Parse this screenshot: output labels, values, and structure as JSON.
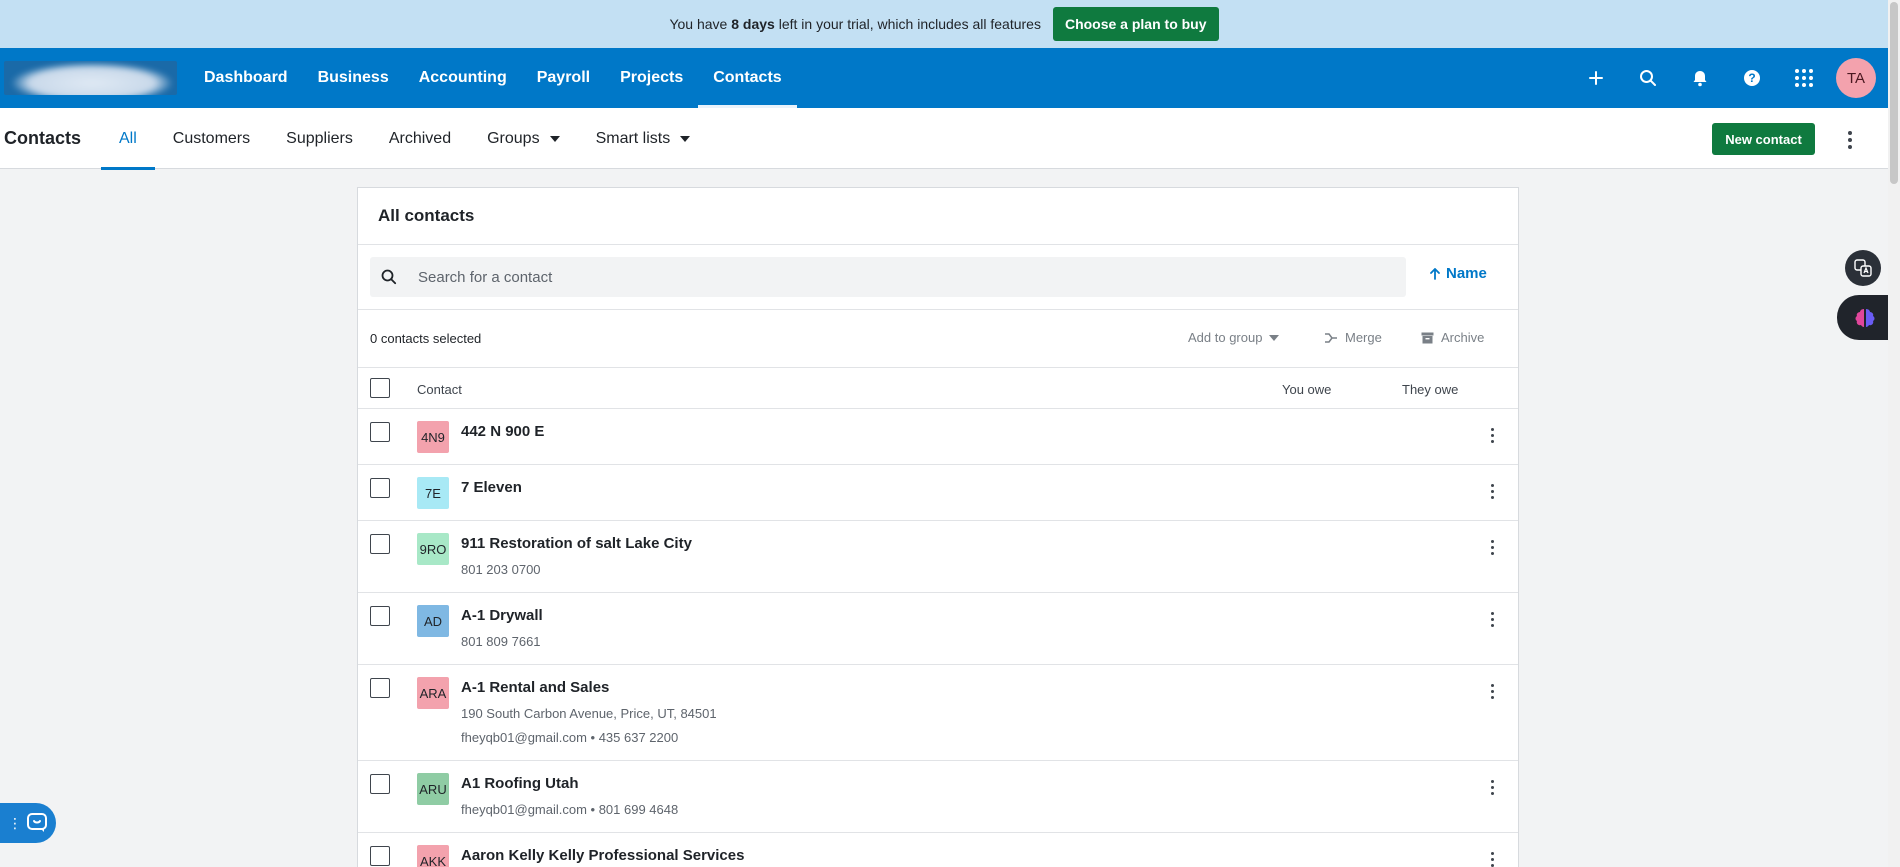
{
  "trial": {
    "text_before": "You have",
    "days": "8 days",
    "text_after": "left in your trial, which includes all features",
    "cta": "Choose a plan to buy"
  },
  "nav": {
    "links": [
      "Dashboard",
      "Business",
      "Accounting",
      "Payroll",
      "Projects",
      "Contacts"
    ],
    "active": "Contacts",
    "icons": [
      "plus-icon",
      "search-icon",
      "bell-icon",
      "help-icon",
      "app-grid-icon"
    ],
    "avatar_initials": "TA"
  },
  "subnav": {
    "title": "Contacts",
    "tabs": [
      "All",
      "Customers",
      "Suppliers",
      "Archived",
      "Groups",
      "Smart lists"
    ],
    "active_tab": "All",
    "new_contact": "New contact"
  },
  "card": {
    "title": "All contacts",
    "search_placeholder": "Search for a contact",
    "sort_label": "Name",
    "selected_count": "0 contacts selected",
    "actions": {
      "add_to_group": "Add to group",
      "merge": "Merge",
      "archive": "Archive"
    },
    "columns": {
      "contact": "Contact",
      "you_owe": "You owe",
      "they_owe": "They owe"
    },
    "rows": [
      {
        "initials": "4N9",
        "color": "#f3a2ad",
        "name": "442 N 900 E",
        "line1": "",
        "line2": ""
      },
      {
        "initials": "7E",
        "color": "#a8e9f5",
        "name": "7 Eleven",
        "line1": "",
        "line2": ""
      },
      {
        "initials": "9RO",
        "color": "#a8e8c7",
        "name": "911 Restoration of salt Lake City",
        "line1": "801 203 0700",
        "line2": ""
      },
      {
        "initials": "AD",
        "color": "#7fb8e3",
        "name": "A-1 Drywall",
        "line1": "801 809 7661",
        "line2": ""
      },
      {
        "initials": "ARA",
        "color": "#f3a2ad",
        "name": "A-1 Rental and Sales",
        "line1": "190 South Carbon Avenue, Price, UT, 84501",
        "line2": "fheyqb01@gmail.com  •  435 637 2200"
      },
      {
        "initials": "ARU",
        "color": "#8fcca4",
        "name": "A1 Roofing Utah",
        "line1": "fheyqb01@gmail.com  •  801 699 4648",
        "line2": ""
      },
      {
        "initials": "AKK",
        "color": "#f3a2ad",
        "name": "Aaron Kelly Kelly Professional Services",
        "line1": "",
        "line2": ""
      }
    ]
  }
}
